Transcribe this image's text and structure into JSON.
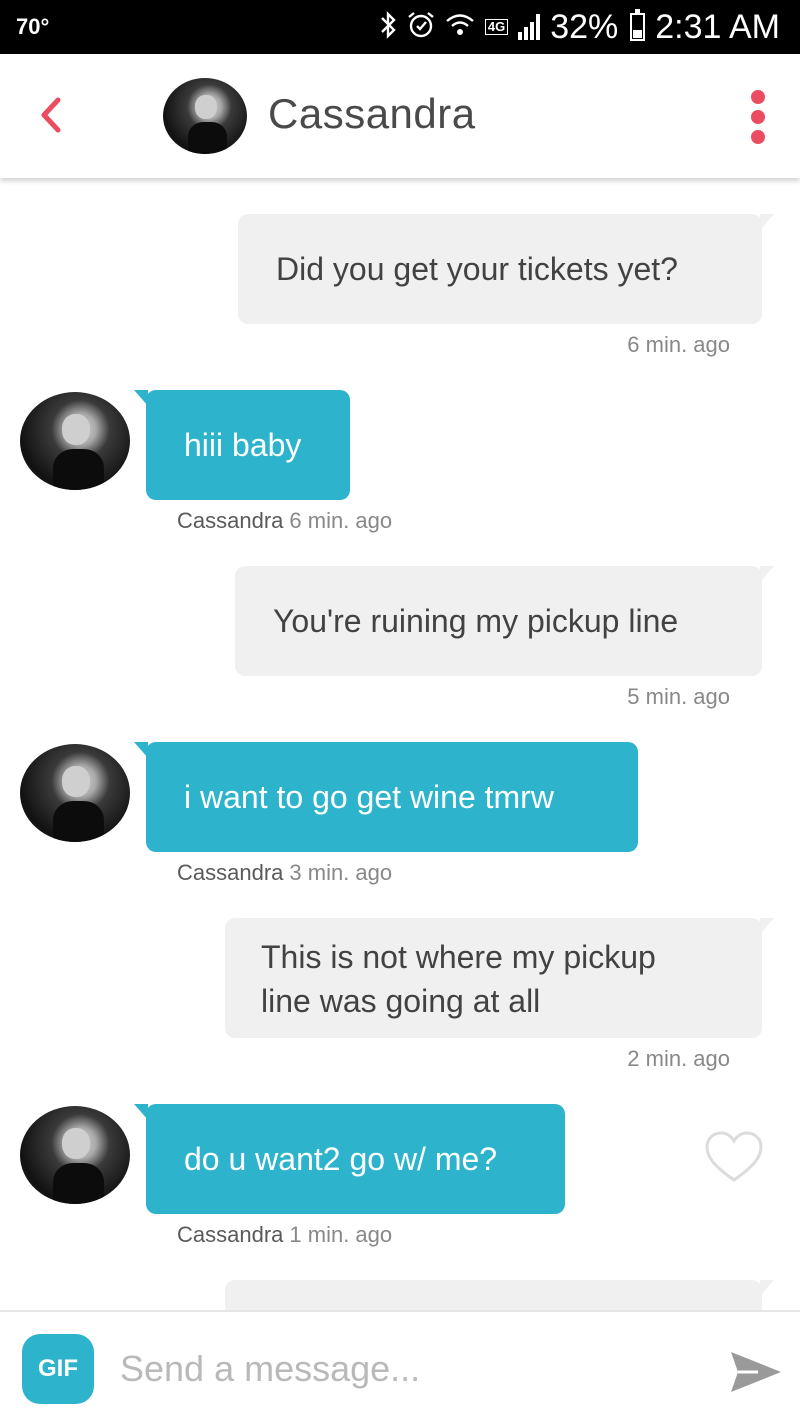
{
  "status_bar": {
    "temperature": "70°",
    "battery": "32%",
    "battery_level": 0.32,
    "network": "4G",
    "time": "2:31 AM",
    "icons": [
      "bluetooth-icon",
      "alarm-icon",
      "wifi-icon",
      "lte-icon",
      "signal-icon",
      "battery-icon"
    ]
  },
  "header": {
    "contact_name": "Cassandra",
    "accent_color": "#ec4c5f"
  },
  "messages": [
    {
      "direction": "outgoing",
      "text": [
        "Did you get your tickets yet?"
      ],
      "time": "6 min. ago"
    },
    {
      "direction": "incoming",
      "sender": "Cassandra",
      "text": [
        "hiii baby"
      ],
      "time": "6 min. ago"
    },
    {
      "direction": "outgoing",
      "text": [
        "You're ruining my pickup line"
      ],
      "time": "5 min. ago"
    },
    {
      "direction": "incoming",
      "sender": "Cassandra",
      "text": [
        "i want to go get wine tmrw"
      ],
      "time": "3 min. ago"
    },
    {
      "direction": "outgoing",
      "text": [
        "This is not where my pickup",
        "line was going at all"
      ],
      "time": "2 min. ago"
    },
    {
      "direction": "incoming",
      "sender": "Cassandra",
      "text": [
        "do u want2 go w/ me?"
      ],
      "time": "1 min. ago"
    }
  ],
  "composer": {
    "gif_label": "GIF",
    "placeholder": "Send a message..."
  },
  "colors": {
    "incoming_bubble": "#2db4cc",
    "outgoing_bubble": "#f0f0f0"
  }
}
